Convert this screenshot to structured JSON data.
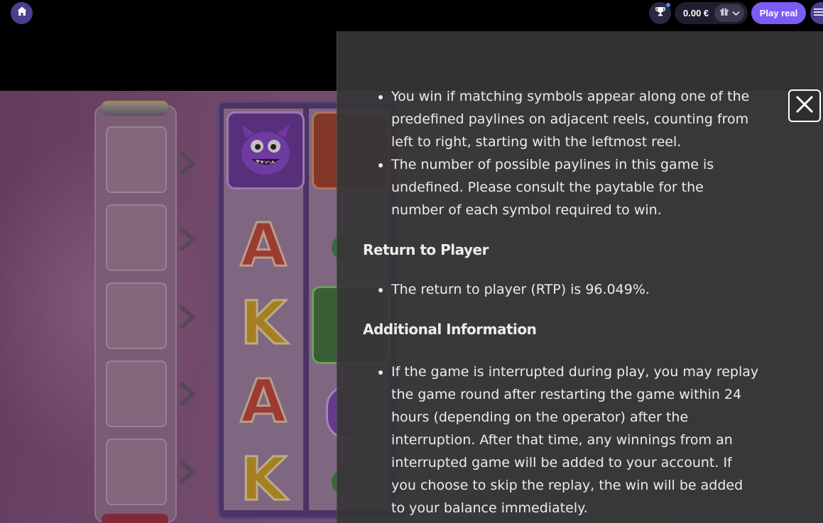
{
  "topbar": {
    "home_icon": "home-icon",
    "trophy_icon": "trophy-icon",
    "balance": "0.00 €",
    "gift_icon": "gift-icon",
    "chevron_icon": "chevron-down-icon",
    "play_real_label": "Play real",
    "menu_icon": "menu-icon"
  },
  "game": {
    "symbols": [
      "A",
      "K",
      "A",
      "K"
    ]
  },
  "info_panel": {
    "paylines_bullets": [
      "You win if matching symbols appear along one of the predefined paylines on adjacent reels, counting from left to right, starting with the leftmost reel.",
      "The number of possible paylines in this game is undefined. Please consult the paytable for the number of each symbol required to win."
    ],
    "rtp_heading": "Return to Player",
    "rtp_bullet": "The return to player (RTP) is 96.049%.",
    "additional_heading": "Additional Information",
    "additional_bullet": "If the game is interrupted during play, you may replay the game round after restarting the game within 24 hours (depending on the operator) after the interruption. After that time, any winnings from an interrupted game will be added to your account. If you choose to skip the replay, the win will be added to your balance immediately.",
    "close_icon": "close-icon"
  },
  "colors": {
    "accent": "#7b5cf5",
    "home_button": "#4b3e8e",
    "panel_bg": "#363636"
  }
}
